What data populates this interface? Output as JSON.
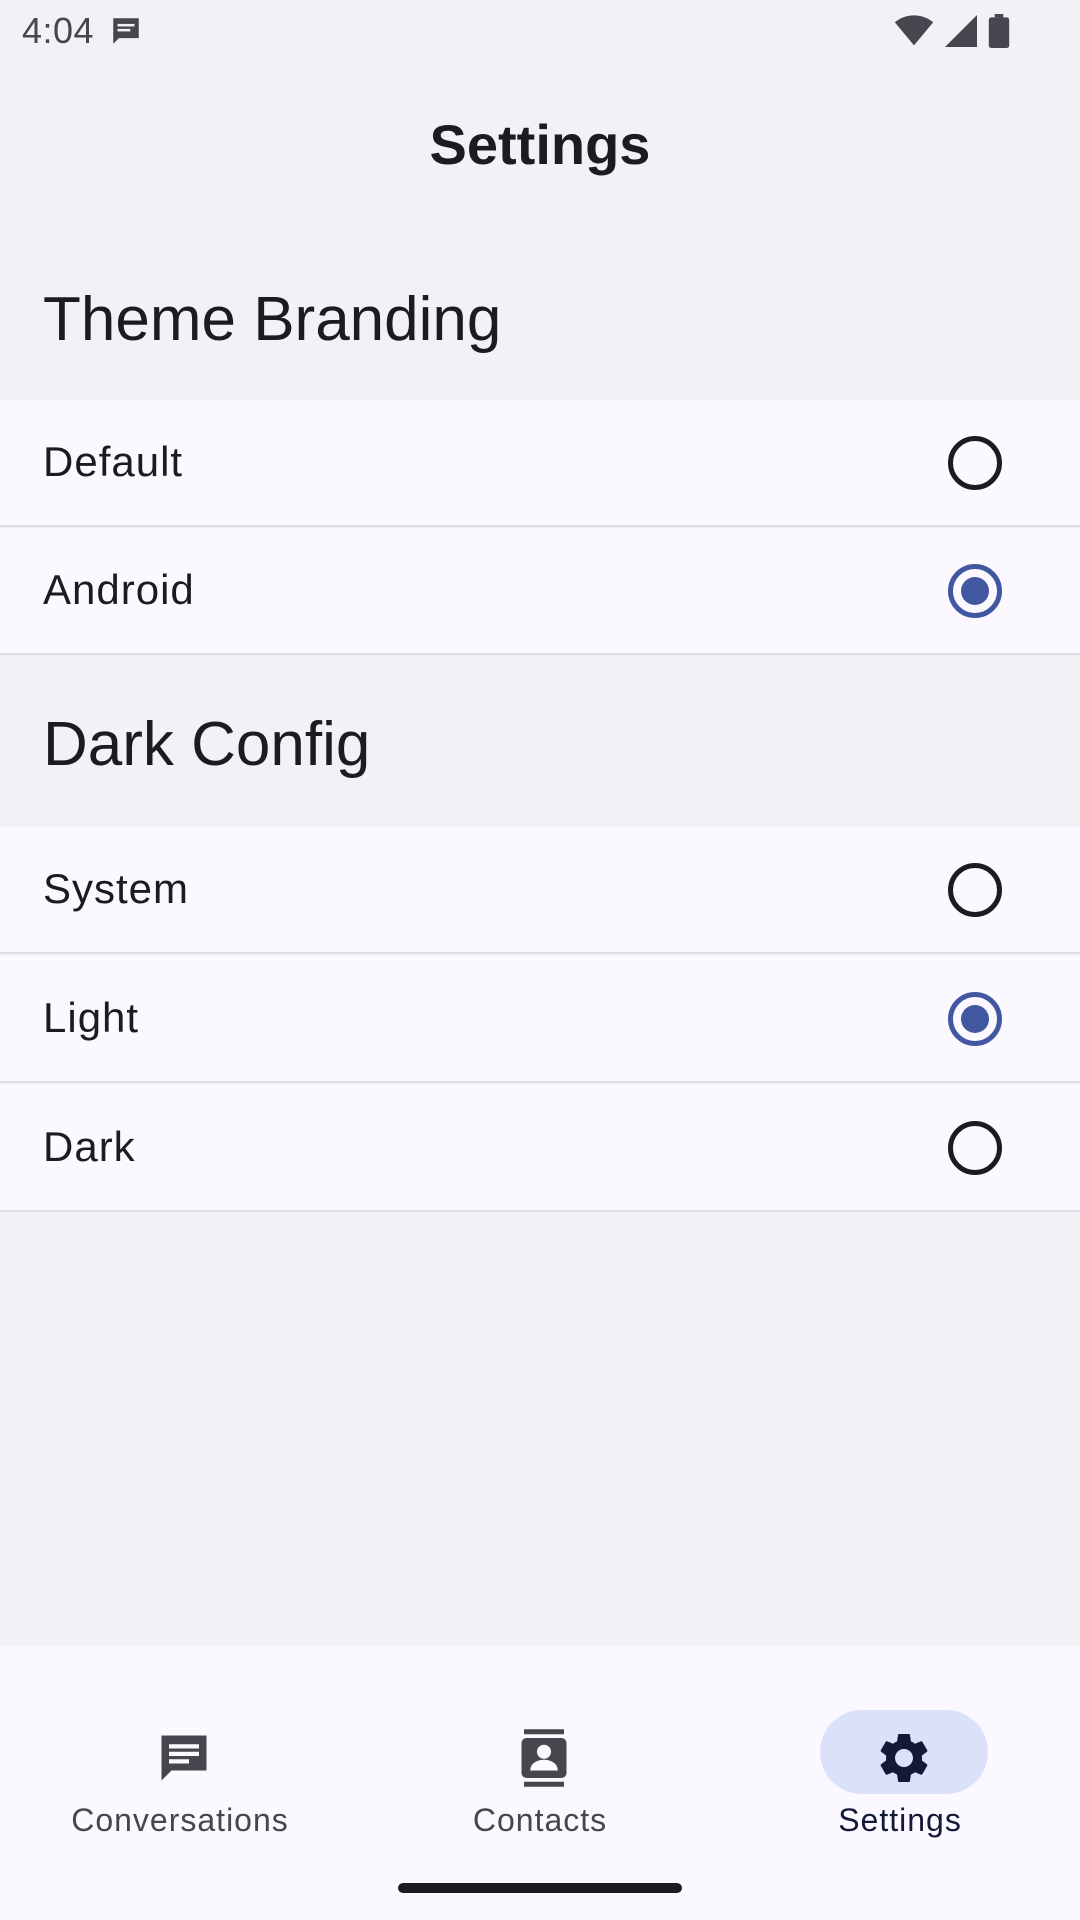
{
  "status_bar": {
    "time": "4:04",
    "icons": [
      "message-icon",
      "wifi-icon",
      "signal-icon",
      "battery-icon"
    ]
  },
  "app": {
    "title": "Settings"
  },
  "sections": [
    {
      "header": "Theme Branding",
      "options": [
        {
          "label": "Default",
          "selected": false
        },
        {
          "label": "Android",
          "selected": true
        }
      ]
    },
    {
      "header": "Dark Config",
      "options": [
        {
          "label": "System",
          "selected": false
        },
        {
          "label": "Light",
          "selected": true
        },
        {
          "label": "Dark",
          "selected": false
        }
      ]
    }
  ],
  "bottom_nav": {
    "items": [
      {
        "label": "Conversations",
        "icon": "chat-icon",
        "active": false
      },
      {
        "label": "Contacts",
        "icon": "contacts-icon",
        "active": false
      },
      {
        "label": "Settings",
        "icon": "gear-icon",
        "active": true
      }
    ]
  },
  "colors": {
    "accent": "#4158a0",
    "nav_active_pill": "#dce1fa",
    "background": "#f1f1f6",
    "surface": "#fbf8ff"
  }
}
